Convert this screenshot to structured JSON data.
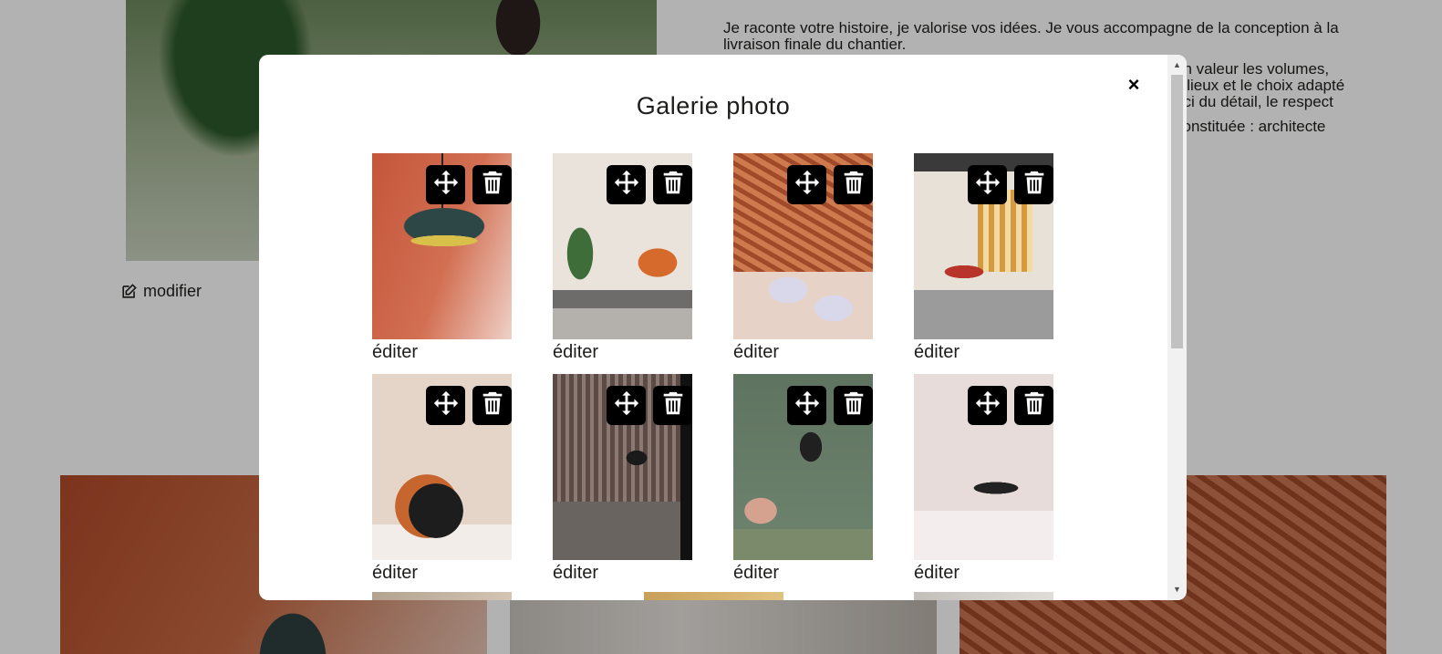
{
  "background": {
    "intro_p1": "Je raconte votre histoire, je valorise vos idées. Je vous accompagne de la conception à la livraison finale du chantier.",
    "intro_p2": "en valeur les volumes,\ns lieux et le choix adapté\nuci du détail, le respect",
    "intro_p3": "constituée : architecte",
    "modifier_label": "modifier"
  },
  "modal": {
    "title": "Galerie photo",
    "close_label": "×",
    "edit_label": "éditer",
    "photos": [
      {
        "icons": [
          "move-icon",
          "trash-icon"
        ]
      },
      {
        "icons": [
          "move-icon",
          "trash-icon"
        ]
      },
      {
        "icons": [
          "move-icon",
          "trash-icon"
        ]
      },
      {
        "icons": [
          "move-icon",
          "trash-icon"
        ]
      },
      {
        "icons": [
          "move-icon",
          "trash-icon"
        ]
      },
      {
        "icons": [
          "move-icon",
          "trash-icon"
        ]
      },
      {
        "icons": [
          "move-icon",
          "trash-icon"
        ]
      },
      {
        "icons": [
          "move-icon",
          "trash-icon"
        ]
      }
    ]
  },
  "colors": {
    "overlay": "rgba(0,0,0,0.30)",
    "action_button_bg": "#000000",
    "text": "#1d1d1b"
  }
}
